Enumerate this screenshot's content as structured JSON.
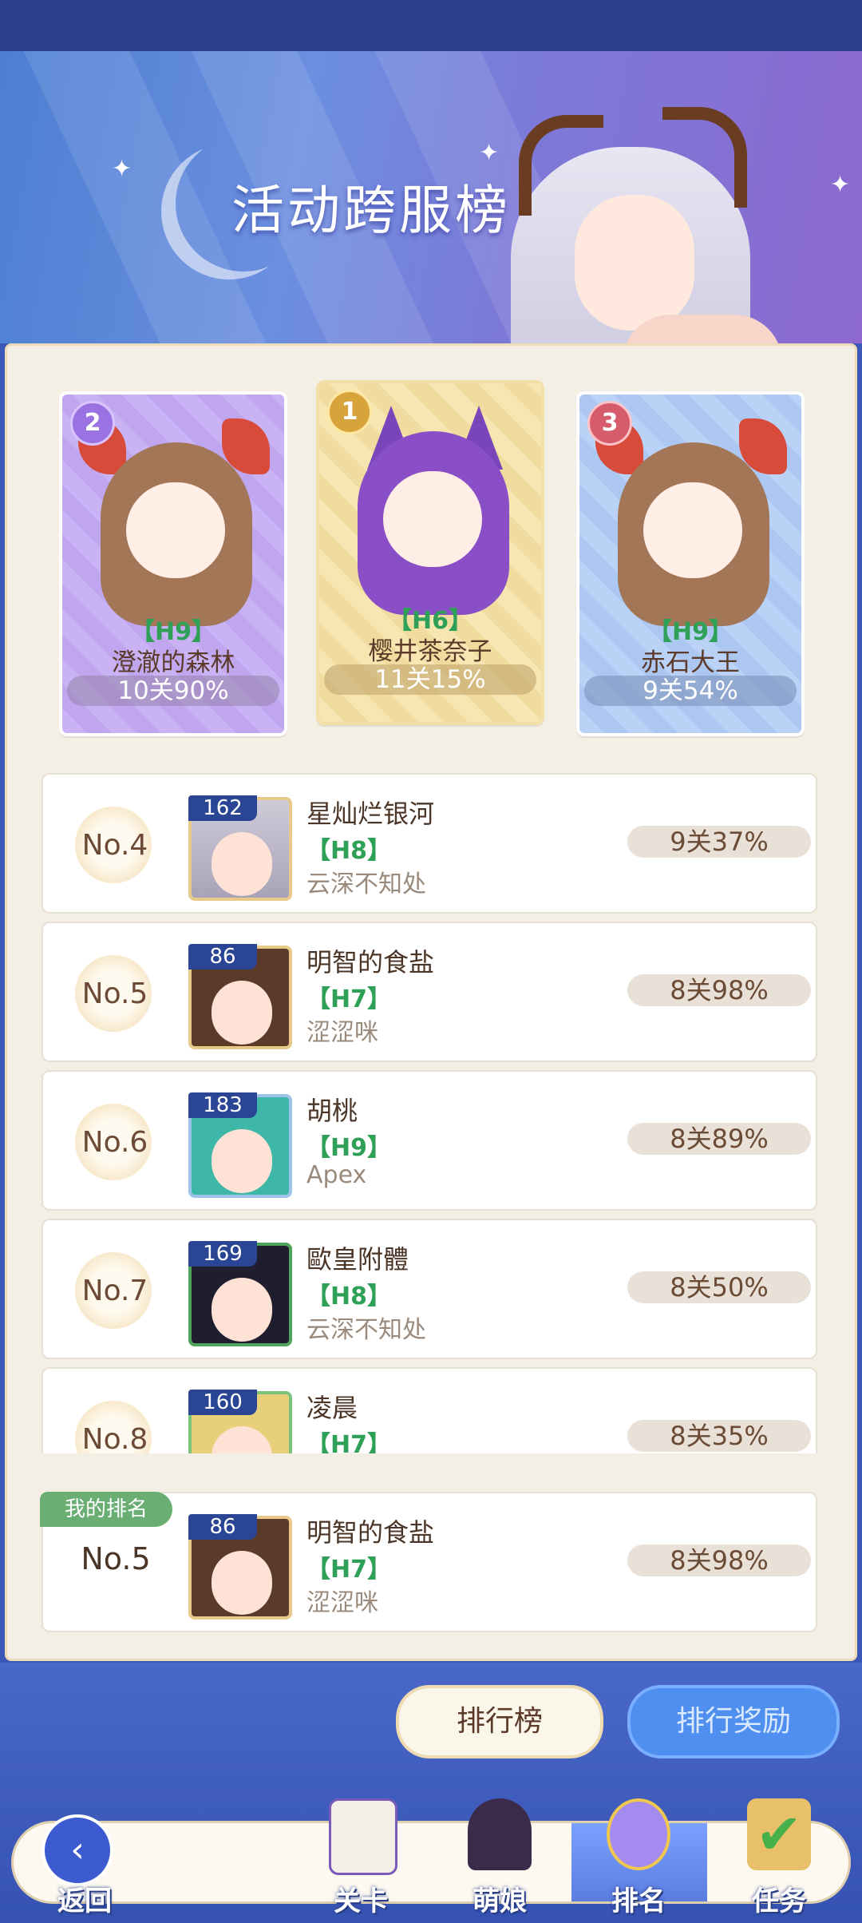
{
  "banner": {
    "title": "活动跨服榜"
  },
  "podium": [
    {
      "rank": "2",
      "level": "【H9】",
      "name": "澄澈的森林",
      "progress": "10关90%"
    },
    {
      "rank": "1",
      "level": "【H6】",
      "name": "樱井茶奈子",
      "progress": "11关15%"
    },
    {
      "rank": "3",
      "level": "【H9】",
      "name": "赤石大王",
      "progress": "9关54%"
    }
  ],
  "rows": [
    {
      "rank": "No.4",
      "avatar_level": "162",
      "name": "星灿烂银河",
      "level": "【H8】",
      "guild": "云深不知处",
      "progress": "9关37%"
    },
    {
      "rank": "No.5",
      "avatar_level": "86",
      "name": "明智的食盐",
      "level": "【H7】",
      "guild": "涩涩咪",
      "progress": "8关98%"
    },
    {
      "rank": "No.6",
      "avatar_level": "183",
      "name": "胡桃",
      "level": "【H9】",
      "guild": "Apex",
      "progress": "8关89%"
    },
    {
      "rank": "No.7",
      "avatar_level": "169",
      "name": "歐皇附體",
      "level": "【H8】",
      "guild": "云深不知处",
      "progress": "8关50%"
    },
    {
      "rank": "No.8",
      "avatar_level": "160",
      "name": "凌晨",
      "level": "【H7】",
      "guild": "",
      "progress": "8关35%"
    }
  ],
  "my_rank": {
    "tag": "我的排名",
    "rank": "No.5",
    "avatar_level": "86",
    "name": "明智的食盐",
    "level": "【H7】",
    "guild": "涩涩咪",
    "progress": "8关98%"
  },
  "buttons": {
    "leaderboard": "排行榜",
    "reward": "排行奖励"
  },
  "nav": [
    {
      "label": "返回",
      "icon": "back-icon"
    },
    {
      "label": "关卡",
      "icon": "castle-icon"
    },
    {
      "label": "萌娘",
      "icon": "girl-icon"
    },
    {
      "label": "排名",
      "icon": "star-medal-icon"
    },
    {
      "label": "任务",
      "icon": "checkmark-scroll-icon"
    }
  ],
  "colors": {
    "accent_green": "#2fa057",
    "name_brown": "#4b3527",
    "reward_blue": "#4f8ff0"
  }
}
